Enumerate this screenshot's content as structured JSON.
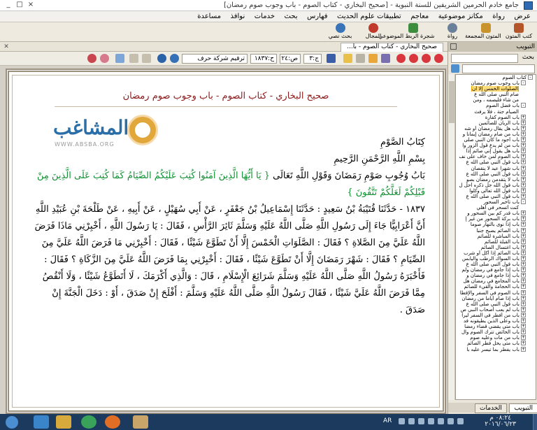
{
  "window": {
    "title": "جامع خادم الحرمين الشريفين للسنة النبوية - [صحيح البخاري - كتاب الصوم - باب وجوب صوم رمضان]",
    "controls": [
      "_",
      "□",
      "×"
    ]
  },
  "menu": [
    "عرض",
    "رواة",
    "مكانز موضوعية",
    "معاجم",
    "تطبيقات علوم الحديث",
    "فهارس",
    "بحث",
    "خدمات",
    "نوافذ",
    "مساعدة"
  ],
  "toolbar": [
    {
      "label": "كتب المتون",
      "icon": "book-icon"
    },
    {
      "label": "المتون المجمعة",
      "icon": "stack-books-icon"
    },
    {
      "label": "رواة",
      "icon": "person-icon"
    },
    {
      "label": "شجرة الربط الموضوعي",
      "icon": "tree-icon"
    },
    {
      "label": "المجال",
      "icon": "globe-icon"
    },
    {
      "label": "بحث نصي",
      "icon": "search-text-icon"
    }
  ],
  "document_tab": "صحيح البخاري - كتاب الصوم - با...",
  "doc_nav": {
    "part": "ج:٣",
    "page": "ص:٢٤",
    "hadith": "ح:١٨٣٧",
    "numbering": "ترقيم شركة حرف"
  },
  "document": {
    "header": "صحيح البخاري - كتاب الصوم - باب وجوب صوم رمضان",
    "logo_text": "المشاغب",
    "logo_url": "WWW.ABSBA.ORG",
    "book_title": "كِتَابُ الصَّوْمِ",
    "basmala": "بِسْمِ اللَّهِ الرَّحْمَنِ الرَّحِيمِ",
    "chapter_prefix": "بَابُ وُجُوبِ صَوْمِ رَمَضَانَ وَقَوْلِ اللَّهِ تَعَالَى",
    "chapter_verse": "{ يَا أَيُّهَا الَّذِينَ آمَنُوا كُتِبَ عَلَيْكُمُ الصِّيَامُ كَمَا كُتِبَ عَلَى الَّذِينَ مِنْ قَبْلِكُمْ لَعَلَّكُمْ تَتَّقُونَ }",
    "hadith_text": "١٨٣٧ - حَدَّثَنَا قُتَيْبَةُ بْنُ سَعِيدٍ : حَدَّثَنَا إِسْمَاعِيلُ بْنُ جَعْفَرٍ ، عَنْ أَبِي سُهَيْلٍ ، عَنْ أَبِيهِ ، عَنْ طَلْحَةَ بْنِ عُبَيْدِ اللَّهِ أَنَّ أَعْرَابِيًّا جَاءَ إِلَى رَسُولِ اللَّهِ صَلَّى اللَّهُ عَلَيْهِ وَسَلَّمَ ثَائِرَ الرَّأْسِ ، فَقَالَ : يَا رَسُولَ اللَّهِ ، أَخْبِرْنِي مَاذَا فَرَضَ اللَّهُ عَلَيَّ مِنَ الصَّلاةِ ؟ فَقَالَ : الصَّلَوَاتِ الْخَمْسَ إِلَّا أَنْ تَطَوَّعَ شَيْئًا ، فَقَالَ : أَخْبِرْنِي مَا فَرَضَ اللَّهُ عَلَيَّ مِنَ الصِّيَامِ ؟ فَقَالَ : شَهْرَ رَمَضَانَ إِلَّا أَنْ تَطَوَّعَ شَيْئًا ، فَقَالَ : أَخْبِرْنِي بِمَا فَرَضَ اللَّهُ عَلَيَّ مِنَ الزَّكَاةِ ؟ فَقَالَ : فَأَخْبَرَهُ رَسُولُ اللَّهِ صَلَّى اللَّهُ عَلَيْهِ وَسَلَّمَ شَرَائِعَ الْإِسْلَامِ ، قَالَ : وَالَّذِي أَكْرَمَكَ ، لَا أَتَطَوَّعُ شَيْئًا ، وَلَا أَنْقُصُ مِمَّا فَرَضَ اللَّهُ عَلَيَّ شَيْئًا ، فَقَالَ رَسُولُ اللَّهِ صَلَّى اللَّهُ عَلَيْهِ وَسَلَّمَ : أَفْلَحَ إِنْ صَدَقَ ، أَوْ : دَخَلَ الْجَنَّةَ إِنْ صَدَقَ ."
  },
  "sidebar": {
    "header": "التبويب",
    "search_label": "بحث",
    "tabs": [
      "التبويب",
      "الخدمات"
    ],
    "tree": [
      {
        "level": 0,
        "text": "كتاب الصوم",
        "exp": "-"
      },
      {
        "level": 1,
        "text": "باب وجوب صوم رمضان",
        "exp": "-"
      },
      {
        "level": 2,
        "text": "الصلوات الخمس إلا أن",
        "selected": true
      },
      {
        "level": 2,
        "text": "صام النبي صلى الله ع"
      },
      {
        "level": 2,
        "text": "من شاء فليصمه ، ومن"
      },
      {
        "level": 1,
        "text": "باب فضل الصوم",
        "exp": "-"
      },
      {
        "level": 2,
        "text": "الصيام جنة ، فلا يرفث"
      },
      {
        "level": 1,
        "text": "باب الصوم كفارة",
        "exp": "+"
      },
      {
        "level": 1,
        "text": "باب الريان للصائمين",
        "exp": "+"
      },
      {
        "level": 1,
        "text": "باب هل يقال رمضان أو شه",
        "exp": "+"
      },
      {
        "level": 1,
        "text": "باب من صام رمضان إيمانا و",
        "exp": "+"
      },
      {
        "level": 1,
        "text": "باب أجود ما كان النبي صلى",
        "exp": "+"
      },
      {
        "level": 1,
        "text": "باب من لم يدع قول الزور وا",
        "exp": "+"
      },
      {
        "level": 1,
        "text": "باب هل يقول إني صائم إذا",
        "exp": "+"
      },
      {
        "level": 1,
        "text": "باب الصوم لمن خاف على نف",
        "exp": "+"
      },
      {
        "level": 1,
        "text": "باب قول النبي صلى الله ع",
        "exp": "+"
      },
      {
        "level": 1,
        "text": "باب شهرا عيد لا ينقصان",
        "exp": "+"
      },
      {
        "level": 1,
        "text": "باب قول النبي صلى الله ع",
        "exp": "+"
      },
      {
        "level": 1,
        "text": "باب لا يتقدمن رمضان بصو",
        "exp": "+"
      },
      {
        "level": 1,
        "text": "باب قول الله جل ذكره أحل ل",
        "exp": "+"
      },
      {
        "level": 1,
        "text": "باب قول الله تعالى وكلوا",
        "exp": "+"
      },
      {
        "level": 1,
        "text": "باب قول النبي صلى الله ع",
        "exp": "+"
      },
      {
        "level": 1,
        "text": "باب تأخير السحور",
        "exp": "-"
      },
      {
        "level": 2,
        "text": "كنت أتسحر في أهلي"
      },
      {
        "level": 1,
        "text": "باب قدر كم بين السحور و",
        "exp": "+"
      },
      {
        "level": 1,
        "text": "باب بركة السحور من غير إ",
        "exp": "+"
      },
      {
        "level": 1,
        "text": "باب إذا نوى بالنهار صوما",
        "exp": "+"
      },
      {
        "level": 1,
        "text": "باب الصائم يصبح جنبا",
        "exp": "+"
      },
      {
        "level": 1,
        "text": "باب المباشرة للصائم",
        "exp": "+"
      },
      {
        "level": 1,
        "text": "باب القبلة للصائم",
        "exp": "+"
      },
      {
        "level": 1,
        "text": "باب اغتسال الصائم",
        "exp": "+"
      },
      {
        "level": 1,
        "text": "باب الصائم إذا أكل أو شرب",
        "exp": "+"
      },
      {
        "level": 1,
        "text": "باب السواك الرطب واليابس",
        "exp": "+"
      },
      {
        "level": 1,
        "text": "باب قول النبي صلى الله ع",
        "exp": "+"
      },
      {
        "level": 1,
        "text": "باب إذا جامع في رمضان ولم",
        "exp": "+"
      },
      {
        "level": 1,
        "text": "باب إذا جامع في رمضان و",
        "exp": "+"
      },
      {
        "level": 1,
        "text": "باب المجامع في رمضان هل",
        "exp": "+"
      },
      {
        "level": 1,
        "text": "باب الحجامة والقيء للصائم",
        "exp": "+"
      },
      {
        "level": 1,
        "text": "باب الصوم في السفر والإفطا",
        "exp": "+"
      },
      {
        "level": 1,
        "text": "باب إذا صام أياما من رمضان",
        "exp": "+"
      },
      {
        "level": 1,
        "text": "باب قول النبي صلى الله ع",
        "exp": "+"
      },
      {
        "level": 1,
        "text": "باب لم يعب أصحاب النبي ص",
        "exp": "+"
      },
      {
        "level": 1,
        "text": "باب من أفطر في السفر ليرا",
        "exp": "+"
      },
      {
        "level": 1,
        "text": "باب وعلى الذين يطيقونه فد",
        "exp": "+"
      },
      {
        "level": 1,
        "text": "باب متى يقضي قضاء رمضا",
        "exp": "+"
      },
      {
        "level": 1,
        "text": "باب الحائض تترك الصوم وال",
        "exp": "+"
      },
      {
        "level": 1,
        "text": "باب من مات وعليه صوم",
        "exp": "+"
      },
      {
        "level": 1,
        "text": "باب متى يحل فطر الصائم",
        "exp": "+"
      },
      {
        "level": 1,
        "text": "باب يفطر بما تيسر عليه با",
        "exp": "+"
      }
    ]
  },
  "taskbar": {
    "lang": "AR",
    "time": "٠٨:٢٤ م",
    "date": "٢٠١٦/٠٦/٢٣"
  }
}
